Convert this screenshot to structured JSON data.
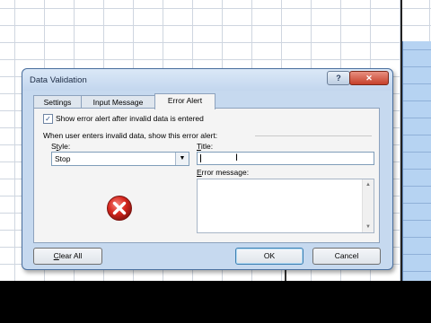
{
  "dialog": {
    "title": "Data Validation",
    "help_glyph": "?",
    "close_glyph": "✕",
    "tabs": [
      {
        "label": "Settings"
      },
      {
        "label": "Input Message"
      },
      {
        "label": "Error Alert"
      }
    ],
    "active_tab": "Error Alert",
    "show_alert": {
      "checked": true,
      "label": "Show error alert after invalid data is entered"
    },
    "section_label": "When user enters invalid data, show this error alert:",
    "style": {
      "label_prefix": "S",
      "label_key": "t",
      "label_suffix": "yle:",
      "value": "Stop",
      "options_visible": [
        "Stop"
      ]
    },
    "title_field": {
      "label_key": "T",
      "label_suffix": "itle:",
      "value": ""
    },
    "error_message": {
      "label_key": "E",
      "label_suffix": "rror message:",
      "value": ""
    },
    "buttons": {
      "clear_key": "C",
      "clear_suffix": "lear All",
      "ok": "OK",
      "cancel": "Cancel"
    },
    "icons": {
      "style_icon": "stop-error-icon",
      "dropdown": "chevron-down-icon"
    }
  },
  "colors": {
    "error_red": "#d8271e",
    "dialog_bg": "#c6d9ef",
    "selected_column": "#b6d3f2"
  }
}
